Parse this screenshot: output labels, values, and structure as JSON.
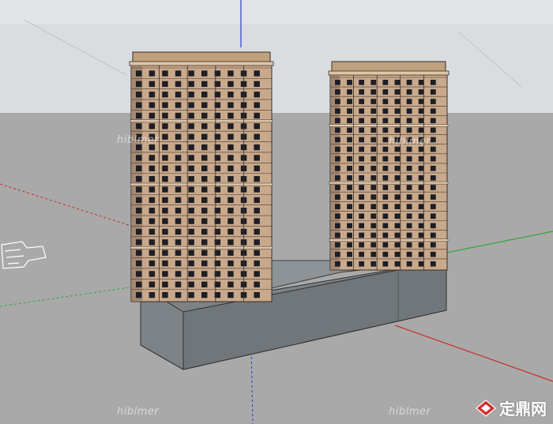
{
  "viewport": {
    "sky_color": "#d9dde0",
    "ground_color": "#a9a9a9"
  },
  "axes": {
    "red_color": "#cc2a2a",
    "green_color": "#2fa83a",
    "blue_color": "#2a3ccc"
  },
  "model": {
    "tower_color": "#c9a98c",
    "podium_color": "#7c8286",
    "window_color": "#1e1e24"
  },
  "watermarks": {
    "text": "hiblmer"
  },
  "brand": {
    "text": "定鼎网",
    "icon": "diamond-logo-icon"
  }
}
